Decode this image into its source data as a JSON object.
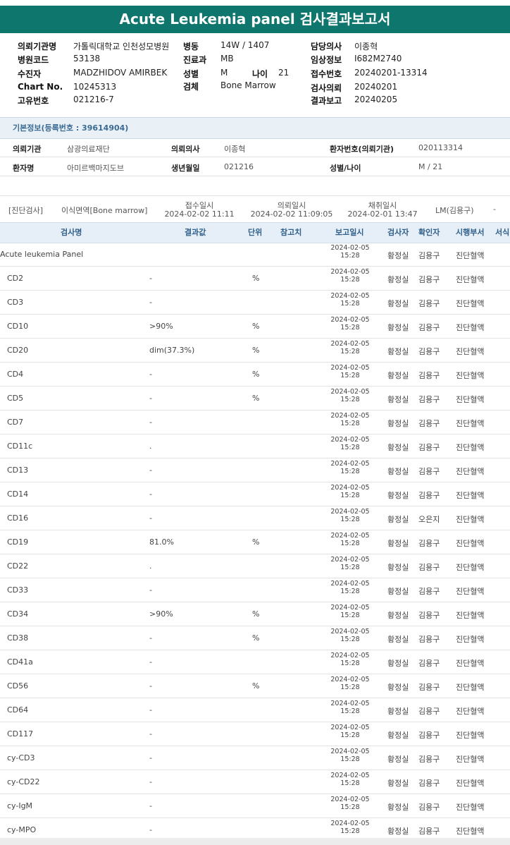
{
  "report": {
    "title": "Acute Leukemia panel 검사결과보고서",
    "header_left": [
      {
        "label": "의뢰기관명",
        "value": "가톨릭대학교 인천성모병원"
      },
      {
        "label": "병원코드",
        "value": "53138"
      },
      {
        "label": "수진자",
        "value": "MADZHIDOV AMIRBEK"
      },
      {
        "label": "Chart No.",
        "value": "10245313"
      },
      {
        "label": "고유번호",
        "value": "021216-7"
      }
    ],
    "header_mid": [
      {
        "label": "병동",
        "value": "14W / 1407"
      },
      {
        "label": "진료과",
        "value": "MB"
      },
      {
        "label": "성별",
        "value": "M"
      },
      {
        "label": "검체",
        "value": "Bone Marrow"
      }
    ],
    "age_label": "나이",
    "age_value": "21",
    "header_right": [
      {
        "label": "담당의사",
        "value": "이종혁"
      },
      {
        "label": "임상정보",
        "value": "I682M2740"
      },
      {
        "label": "접수번호",
        "value": "20240201-13314"
      },
      {
        "label": "검사의뢰",
        "value": "20240201"
      },
      {
        "label": "결과보고",
        "value": "20240205"
      }
    ]
  },
  "basic_info": {
    "title": "기본정보(등록번호 : 39614904)",
    "rows": [
      [
        {
          "label": "의뢰기관",
          "value": "삼광의료재단"
        },
        {
          "label": "의뢰의사",
          "value": "이종혁"
        },
        {
          "label": "환자번호(의뢰기관)",
          "value": "020113314"
        }
      ],
      [
        {
          "label": "환자명",
          "value": "아미르백마지도브"
        },
        {
          "label": "생년월일",
          "value": "021216"
        },
        {
          "label": "성별/나이",
          "value": "M / 21"
        }
      ]
    ]
  },
  "request": {
    "category": "[진단검사]",
    "specimen": "이식면역[Bone marrow]",
    "received_label": "접수일시",
    "received": "2024-02-02 11:11",
    "requested_label": "의뢰일시",
    "requested": "2024-02-02 11:09:05",
    "collected_label": "채취일시",
    "collected": "2024-02-01 13:47",
    "reviewer": "LM(김용구)",
    "dash": "-"
  },
  "table": {
    "headers": [
      "검사명",
      "결과값",
      "단위",
      "참고치",
      "보고일시",
      "검사자",
      "확인자",
      "시행부서",
      "서식"
    ],
    "rows": [
      {
        "name": "Acute leukemia Panel",
        "result": "",
        "unit": "",
        "date": "2024-02-05",
        "time": "15:28",
        "tester": "황정실",
        "confirmer": "김용구",
        "dept": "진단혈액"
      },
      {
        "name": "CD2",
        "result": "-",
        "unit": "%",
        "date": "2024-02-05",
        "time": "15:28",
        "tester": "황정실",
        "confirmer": "김용구",
        "dept": "진단혈액"
      },
      {
        "name": "CD3",
        "result": "-",
        "unit": "",
        "date": "2024-02-05",
        "time": "15:28",
        "tester": "황정실",
        "confirmer": "김용구",
        "dept": "진단혈액"
      },
      {
        "name": "CD10",
        "result": ">90%",
        "unit": "%",
        "date": "2024-02-05",
        "time": "15:28",
        "tester": "황정실",
        "confirmer": "김용구",
        "dept": "진단혈액"
      },
      {
        "name": "CD20",
        "result": "dim(37.3%)",
        "unit": "%",
        "date": "2024-02-05",
        "time": "15:28",
        "tester": "황정실",
        "confirmer": "김용구",
        "dept": "진단혈액"
      },
      {
        "name": "CD4",
        "result": "-",
        "unit": "%",
        "date": "2024-02-05",
        "time": "15:28",
        "tester": "황정실",
        "confirmer": "김용구",
        "dept": "진단혈액"
      },
      {
        "name": "CD5",
        "result": "-",
        "unit": "%",
        "date": "2024-02-05",
        "time": "15:28",
        "tester": "황정실",
        "confirmer": "김용구",
        "dept": "진단혈액"
      },
      {
        "name": "CD7",
        "result": "-",
        "unit": "",
        "date": "2024-02-05",
        "time": "15:28",
        "tester": "황정실",
        "confirmer": "김용구",
        "dept": "진단혈액"
      },
      {
        "name": "CD11c",
        "result": ".",
        "unit": "",
        "date": "2024-02-05",
        "time": "15:28",
        "tester": "황정실",
        "confirmer": "김용구",
        "dept": "진단혈액"
      },
      {
        "name": "CD13",
        "result": "-",
        "unit": "",
        "date": "2024-02-05",
        "time": "15:28",
        "tester": "황정실",
        "confirmer": "김용구",
        "dept": "진단혈액"
      },
      {
        "name": "CD14",
        "result": "-",
        "unit": "",
        "date": "2024-02-05",
        "time": "15:28",
        "tester": "황정실",
        "confirmer": "김용구",
        "dept": "진단혈액"
      },
      {
        "name": "CD16",
        "result": "-",
        "unit": "",
        "date": "2024-02-05",
        "time": "15:28",
        "tester": "황정실",
        "confirmer": "오은지",
        "dept": "진단혈액"
      },
      {
        "name": "CD19",
        "result": "81.0%",
        "unit": "%",
        "date": "2024-02-05",
        "time": "15:28",
        "tester": "황정실",
        "confirmer": "김용구",
        "dept": "진단혈액"
      },
      {
        "name": "CD22",
        "result": ".",
        "unit": "",
        "date": "2024-02-05",
        "time": "15:28",
        "tester": "황정실",
        "confirmer": "김용구",
        "dept": "진단혈액"
      },
      {
        "name": "CD33",
        "result": "-",
        "unit": "",
        "date": "2024-02-05",
        "time": "15:28",
        "tester": "황정실",
        "confirmer": "김용구",
        "dept": "진단혈액"
      },
      {
        "name": "CD34",
        "result": ">90%",
        "unit": "%",
        "date": "2024-02-05",
        "time": "15:28",
        "tester": "황정실",
        "confirmer": "김용구",
        "dept": "진단혈액"
      },
      {
        "name": "CD38",
        "result": "-",
        "unit": "%",
        "date": "2024-02-05",
        "time": "15:28",
        "tester": "황정실",
        "confirmer": "김용구",
        "dept": "진단혈액"
      },
      {
        "name": "CD41a",
        "result": "-",
        "unit": "",
        "date": "2024-02-05",
        "time": "15:28",
        "tester": "황정실",
        "confirmer": "김용구",
        "dept": "진단혈액"
      },
      {
        "name": "CD56",
        "result": "-",
        "unit": "%",
        "date": "2024-02-05",
        "time": "15:28",
        "tester": "황정실",
        "confirmer": "김용구",
        "dept": "진단혈액"
      },
      {
        "name": "CD64",
        "result": "-",
        "unit": "",
        "date": "2024-02-05",
        "time": "15:28",
        "tester": "황정실",
        "confirmer": "김용구",
        "dept": "진단혈액"
      },
      {
        "name": "CD117",
        "result": "-",
        "unit": "",
        "date": "2024-02-05",
        "time": "15:28",
        "tester": "황정실",
        "confirmer": "김용구",
        "dept": "진단혈액"
      },
      {
        "name": "cy-CD3",
        "result": "-",
        "unit": "",
        "date": "2024-02-05",
        "time": "15:28",
        "tester": "황정실",
        "confirmer": "김용구",
        "dept": "진단혈액"
      },
      {
        "name": "cy-CD22",
        "result": "-",
        "unit": "",
        "date": "2024-02-05",
        "time": "15:28",
        "tester": "황정실",
        "confirmer": "김용구",
        "dept": "진단혈액"
      },
      {
        "name": "cy-IgM",
        "result": "-",
        "unit": "",
        "date": "2024-02-05",
        "time": "15:28",
        "tester": "황정실",
        "confirmer": "김용구",
        "dept": "진단혈액"
      },
      {
        "name": "cy-MPO",
        "result": "-",
        "unit": "",
        "date": "2024-02-05",
        "time": "15:28",
        "tester": "황정실",
        "confirmer": "김용구",
        "dept": "진단혈액"
      }
    ]
  }
}
